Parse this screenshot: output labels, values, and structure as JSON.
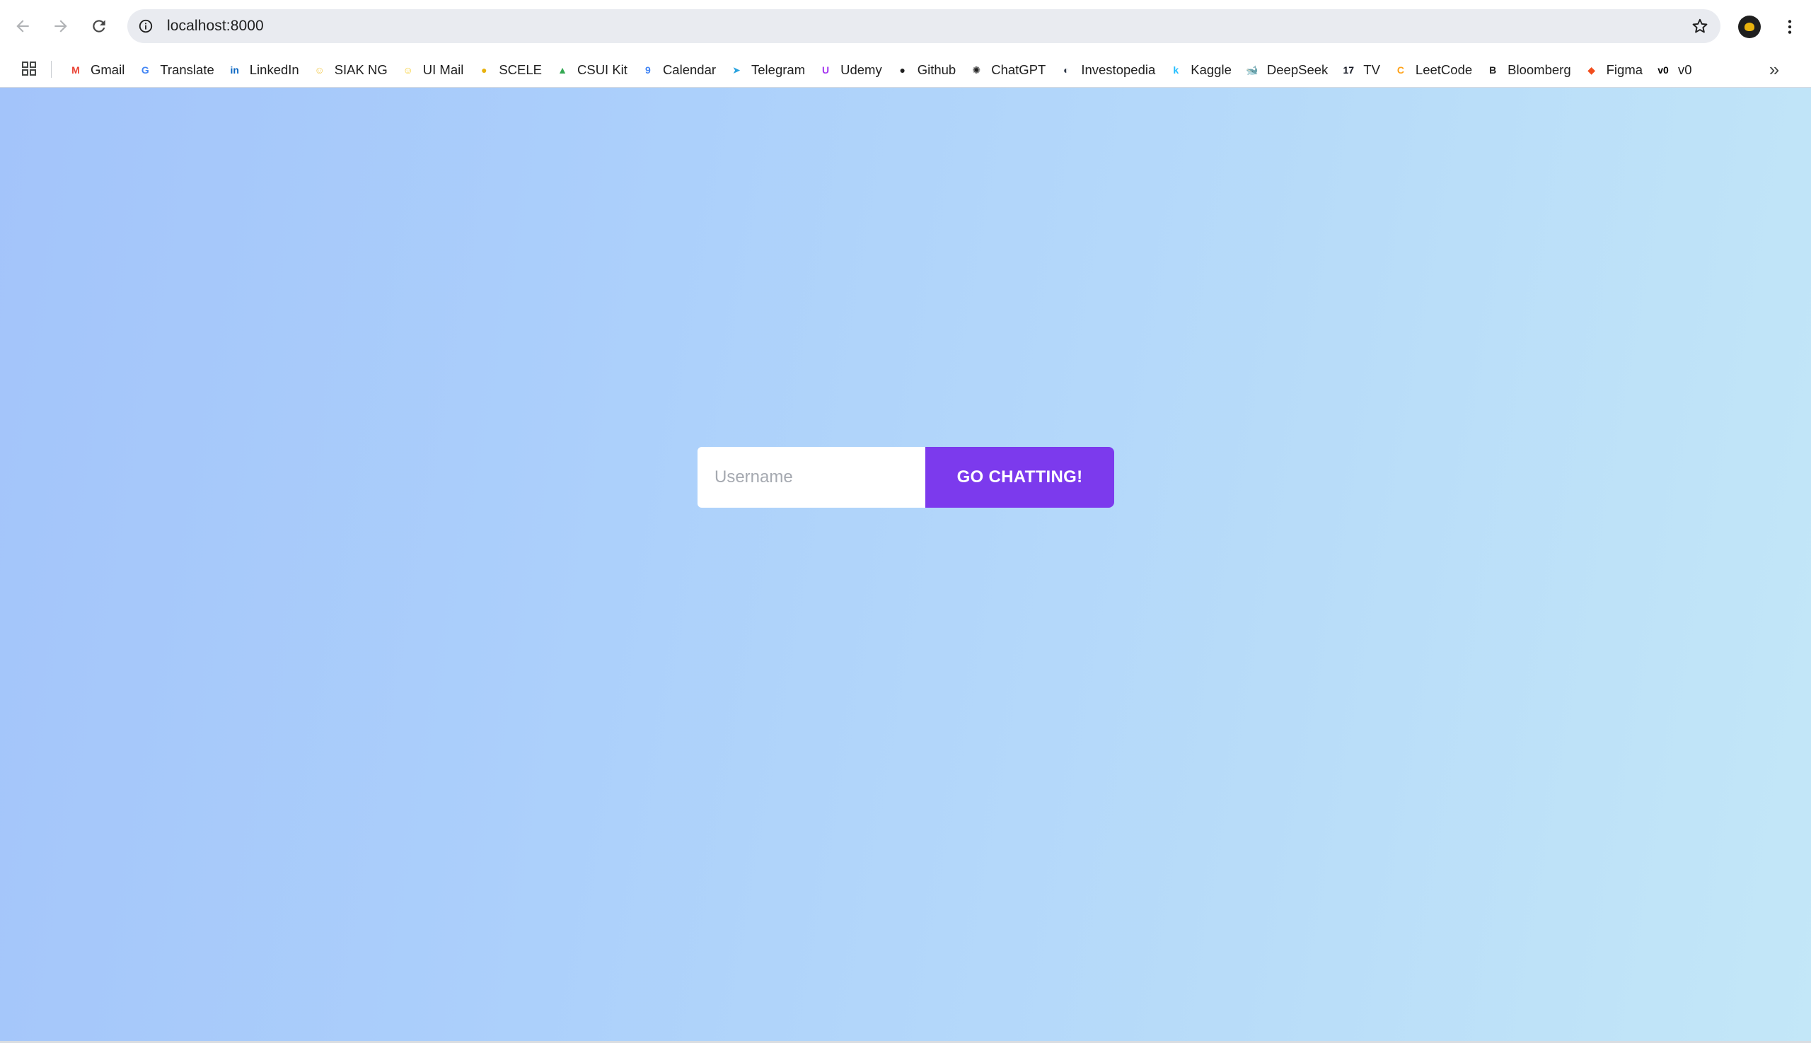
{
  "browser": {
    "url": "localhost:8000"
  },
  "bookmarks": [
    {
      "label": "Gmail",
      "icon": "gmail-icon",
      "color": "#ea4335",
      "glyph": "M"
    },
    {
      "label": "Translate",
      "icon": "translate-icon",
      "color": "#4285f4",
      "glyph": "G"
    },
    {
      "label": "LinkedIn",
      "icon": "linkedin-icon",
      "color": "#0a66c2",
      "glyph": "in"
    },
    {
      "label": "SIAK NG",
      "icon": "siak-icon",
      "color": "#f2c94c",
      "glyph": "☺"
    },
    {
      "label": "UI Mail",
      "icon": "ui-mail-icon",
      "color": "#f7d038",
      "glyph": "☺"
    },
    {
      "label": "SCELE",
      "icon": "scele-icon",
      "color": "#e8b20e",
      "glyph": "●"
    },
    {
      "label": "CSUI Kit",
      "icon": "google-drive-icon",
      "color": "#34a853",
      "glyph": "▲"
    },
    {
      "label": "Calendar",
      "icon": "calendar-icon",
      "color": "#4285f4",
      "glyph": "9"
    },
    {
      "label": "Telegram",
      "icon": "telegram-icon",
      "color": "#2aa3df",
      "glyph": "➤"
    },
    {
      "label": "Udemy",
      "icon": "udemy-icon",
      "color": "#a435f0",
      "glyph": "U"
    },
    {
      "label": "Github",
      "icon": "github-icon",
      "color": "#1f1f1f",
      "glyph": "●"
    },
    {
      "label": "ChatGPT",
      "icon": "chatgpt-icon",
      "color": "#1f1f1f",
      "glyph": "✺"
    },
    {
      "label": "Investopedia",
      "icon": "investopedia-icon",
      "color": "#2d3748",
      "glyph": "◐"
    },
    {
      "label": "Kaggle",
      "icon": "kaggle-icon",
      "color": "#20beff",
      "glyph": "k"
    },
    {
      "label": "DeepSeek",
      "icon": "deepseek-icon",
      "color": "#4d6bfe",
      "glyph": "🐋"
    },
    {
      "label": "TV",
      "icon": "tradingview-icon",
      "color": "#131722",
      "glyph": "17"
    },
    {
      "label": "LeetCode",
      "icon": "leetcode-icon",
      "color": "#ffa116",
      "glyph": "C"
    },
    {
      "label": "Bloomberg",
      "icon": "bloomberg-icon",
      "color": "#1f1f1f",
      "glyph": "B"
    },
    {
      "label": "Figma",
      "icon": "figma-icon",
      "color": "#f24e1e",
      "glyph": "◆"
    },
    {
      "label": "v0",
      "icon": "v0-icon",
      "color": "#000000",
      "glyph": "v0"
    }
  ],
  "login": {
    "username_placeholder": "Username",
    "username_value": "",
    "button_label": "GO CHATTING!"
  },
  "colors": {
    "accent": "#7c3aed",
    "background_start": "#a3c4fa",
    "background_end": "#c3e7f8"
  }
}
